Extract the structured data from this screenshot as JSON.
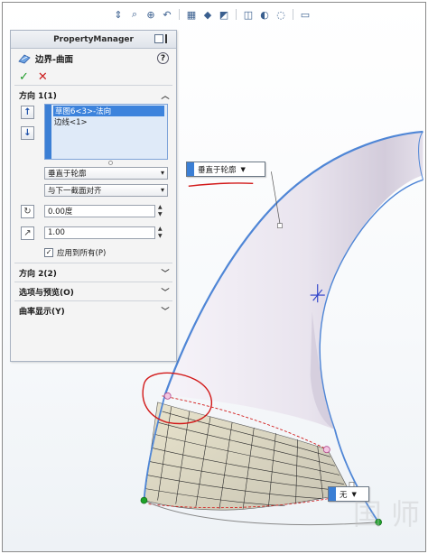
{
  "property_manager": {
    "title": "PropertyManager",
    "feature_name": "边界-曲面",
    "help": "?",
    "ok": "✓",
    "cancel": "✕"
  },
  "direction1": {
    "header": "方向 1(1)",
    "items": [
      "草图6<3>-法向",
      "边线<1>"
    ],
    "selected_index": 0,
    "tangent_type": "垂直于轮廓",
    "alignment": "与下一截面对齐",
    "draft_angle": "0.00度",
    "tangent_length": "1.00",
    "apply_all_label": "应用到所有(P)",
    "apply_all_checked": true
  },
  "sections": {
    "direction2": "方向 2(2)",
    "options_preview": "选项与预览(O)",
    "curvature_display": "曲率显示(Y)"
  },
  "callouts": {
    "top": "垂直于轮廓",
    "bottom": "无"
  },
  "watermark": "国 师",
  "colors": {
    "selection_blue": "#3d83dc",
    "edge_blue": "#4f86d6",
    "annotation_red": "#d21a1a",
    "ok_green": "#1e9b28"
  }
}
